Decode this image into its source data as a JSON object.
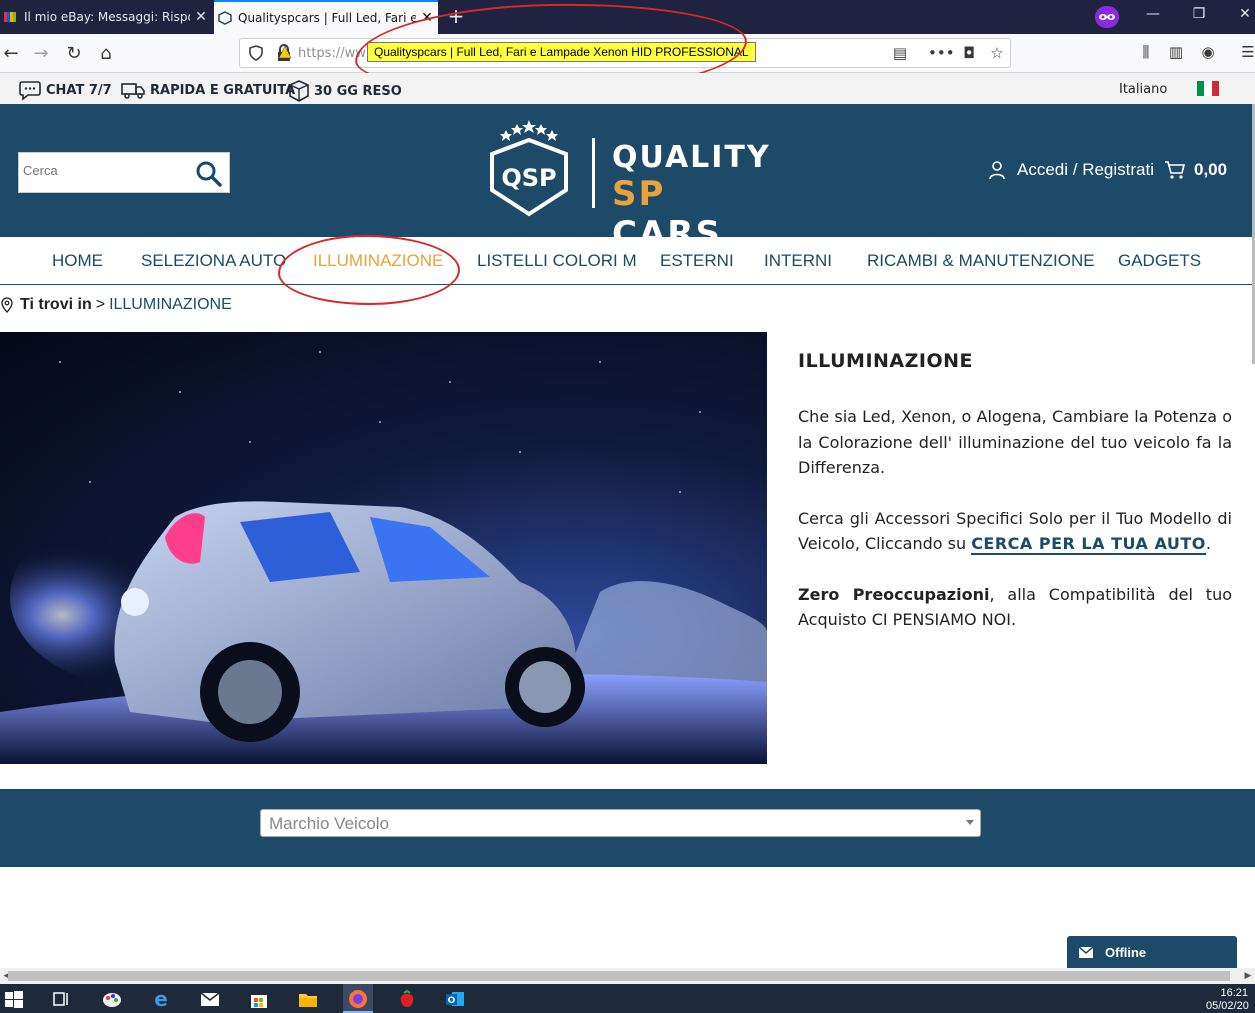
{
  "browser": {
    "tabs": [
      {
        "title": "Il mio eBay: Messaggi: Rispondi",
        "active": false
      },
      {
        "title": "Qualityspcars | Full Led, Fari e L",
        "active": true
      }
    ],
    "url_prefix": "https://ww",
    "tooltip": "Qualityspcars | Full Led, Fari e Lampade Xenon HID PROFESSIONAL"
  },
  "infostrip": {
    "items": [
      "CHAT 7/7",
      "RAPIDA E GRATUITA",
      "30 GG RESO"
    ],
    "language": "Italiano"
  },
  "header": {
    "search_placeholder": "Cerca",
    "logo_mark": "QSP",
    "logo_line1": "QUALITY",
    "logo_sp": "SP",
    "logo_cars": "CARS",
    "account_label": "Accedi / Registrati",
    "cart_total": "0,00"
  },
  "mainnav": {
    "items": [
      "HOME",
      "SELEZIONA AUTO",
      "ILLUMINAZIONE",
      "LISTELLI COLORI M",
      "ESTERNI",
      "INTERNI",
      "RICAMBI & MANUTENZIONE",
      "GADGETS"
    ],
    "active": "ILLUMINAZIONE"
  },
  "breadcrumb": {
    "label": "Ti trovi in",
    "separator": ">",
    "current": "ILLUMINAZIONE"
  },
  "content": {
    "heading": "ILLUMINAZIONE",
    "p1": "Che sia Led, Xenon, o Alogena, Cambiare la Potenza o la Colorazione dell' illuminazione del tuo veicolo fa la Differenza.",
    "p2_before": "Cerca gli Accessori Specifici Solo per il Tuo Modello di Veicolo, Cliccando su ",
    "p2_link": "CERCA PER LA TUA AUTO",
    "p2_after": ".",
    "p3_bold": "Zero Preoccupazioni",
    "p3_rest": ", alla Compatibilità del tuo Acquisto CI PENSIAMO NOI."
  },
  "filter": {
    "brand_placeholder": "Marchio Veicolo"
  },
  "chat": {
    "status": "Offline"
  },
  "taskbar": {
    "time": "16:21",
    "date": "05/02/20"
  },
  "colors": {
    "brand_blue": "#1c4a68",
    "accent_orange": "#e8a33a",
    "annotation_red": "#d42a2a"
  }
}
